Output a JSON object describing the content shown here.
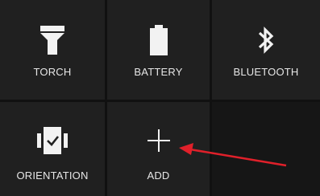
{
  "quick_settings": {
    "tiles": [
      {
        "id": "torch",
        "label": "TORCH",
        "icon": "torch-icon"
      },
      {
        "id": "battery",
        "label": "BATTERY",
        "icon": "battery-icon"
      },
      {
        "id": "bluetooth",
        "label": "BLUETOOTH",
        "icon": "bluetooth-icon"
      },
      {
        "id": "orientation",
        "label": "ORIENTATION",
        "icon": "orientation-lock-icon"
      },
      {
        "id": "add",
        "label": "ADD",
        "icon": "plus-icon"
      }
    ]
  },
  "annotation": {
    "arrow_color": "#e0202a"
  },
  "colors": {
    "tile_bg": "#202020",
    "page_bg": "#111111",
    "text": "#e6e6e6"
  }
}
